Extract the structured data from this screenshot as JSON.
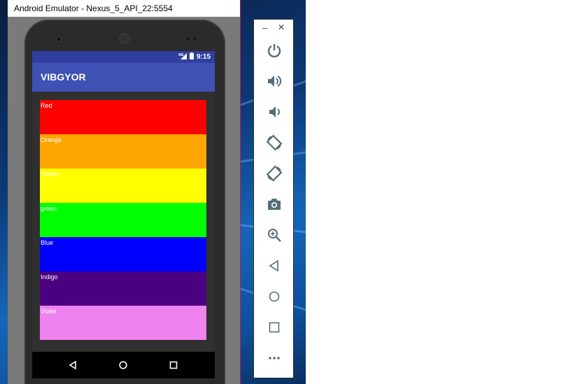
{
  "window": {
    "title": "Android Emulator - Nexus_5_API_22:5554"
  },
  "status_bar": {
    "time": "9:15",
    "icons": [
      "lte-signal-icon",
      "battery-icon"
    ]
  },
  "app": {
    "title": "VIBGYOR"
  },
  "colors": {
    "primary": "#3f51b5",
    "primary_dark": "#303f9f",
    "background": "#303030"
  },
  "bands": [
    {
      "label": "Red",
      "color": "#ff0000",
      "text_color": "#ffffff"
    },
    {
      "label": "Orange",
      "color": "#ffa500",
      "text_color": "#ffffff"
    },
    {
      "label": "Yellow",
      "color": "#ffff00",
      "text_color": "#ffffff"
    },
    {
      "label": "green",
      "color": "#00ff00",
      "text_color": "#ffffff"
    },
    {
      "label": "Blue",
      "color": "#0000ff",
      "text_color": "#ffffff"
    },
    {
      "label": "Indigo",
      "color": "#4b0082",
      "text_color": "#ffffff"
    },
    {
      "label": "Violet",
      "color": "#ee82ee",
      "text_color": "#ffffff"
    }
  ],
  "nav_buttons": [
    "back-icon",
    "home-icon",
    "recents-icon"
  ],
  "toolbar": {
    "window_controls": {
      "minimize": "–",
      "close": "✕"
    },
    "buttons": [
      "power-icon",
      "volume-up-icon",
      "volume-down-icon",
      "rotate-left-icon",
      "rotate-right-icon",
      "camera-icon",
      "zoom-icon",
      "back-icon",
      "home-icon",
      "overview-icon",
      "more-icon"
    ]
  }
}
